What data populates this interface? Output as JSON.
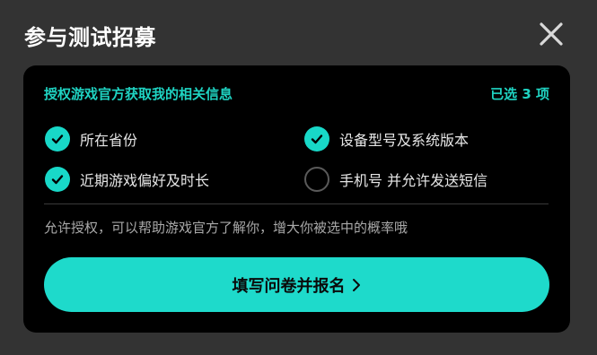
{
  "dialog": {
    "title": "参与测试招募"
  },
  "card": {
    "heading": "授权游戏官方获取我的相关信息",
    "selected_count": "已选 3 项",
    "options": [
      {
        "label": "所在省份",
        "checked": true
      },
      {
        "label": "设备型号及系统版本",
        "checked": true
      },
      {
        "label": "近期游戏偏好及时长",
        "checked": true
      },
      {
        "label": "手机号 并允许发送短信",
        "checked": false
      }
    ],
    "note": "允许授权，可以帮助游戏官方了解你，增大你被选中的概率哦",
    "cta_label": "填写问卷并报名"
  },
  "colors": {
    "accent": "#1edacb",
    "background": "#333333",
    "card": "#000000"
  },
  "icons": {
    "close": "close-icon",
    "check": "checkmark-icon",
    "chevron": "chevron-right-icon"
  }
}
